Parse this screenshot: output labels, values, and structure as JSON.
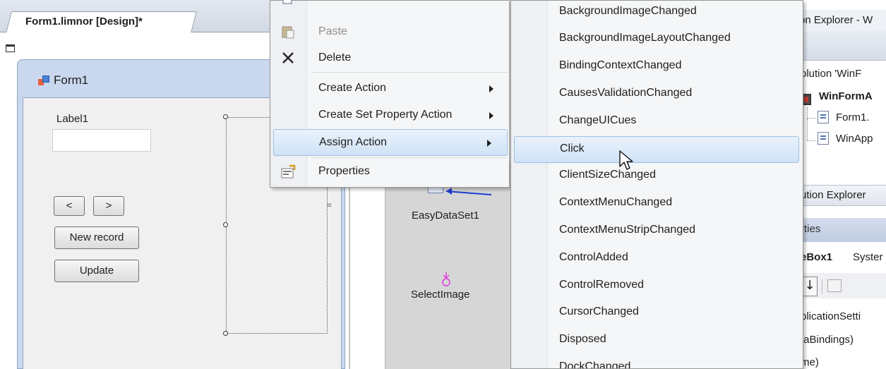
{
  "designer": {
    "tab_label": "Form1.limnor [Design]*",
    "form_title": "Form1",
    "label1": "Label1",
    "prev_button": "<",
    "next_button": ">",
    "new_record_button": "New record",
    "update_button": "Update",
    "tray": {
      "dataset_label": "EasyDataSet1",
      "select_image_label": "SelectImage"
    }
  },
  "context_menu": {
    "items": [
      {
        "label": "Paste",
        "icon": "paste-icon",
        "disabled": true
      },
      {
        "label": "Delete",
        "icon": "delete-icon"
      },
      {
        "label": "Create Action",
        "submenu": true
      },
      {
        "label": "Create Set Property Action",
        "submenu": true
      },
      {
        "label": "Assign Action",
        "submenu": true,
        "highlighted": true
      },
      {
        "label": "Properties",
        "icon": "properties-icon"
      }
    ]
  },
  "submenu": {
    "items": [
      "BackgroundImageChanged",
      "BackgroundImageLayoutChanged",
      "BindingContextChanged",
      "CausesValidationChanged",
      "ChangeUICues",
      "Click",
      "ClientSizeChanged",
      "ContextMenuChanged",
      "ContextMenuStripChanged",
      "ControlAdded",
      "ControlRemoved",
      "CursorChanged",
      "Disposed",
      "DockChanged"
    ],
    "highlighted": "Click"
  },
  "solution_explorer": {
    "header": "on Explorer - W",
    "solution": "olution 'WinF",
    "project": "WinFormA",
    "file1": "Form1.",
    "file2": "WinApp",
    "footer": "ution Explorer"
  },
  "properties": {
    "header": "rties",
    "object_name": "eBox1",
    "object_type": "Syster",
    "rows": [
      "plicationSetti",
      "taBindings)",
      "me)"
    ]
  },
  "colors": {
    "menu_highlight": "#cfe2f6",
    "menu_highlight_border": "#9dc0e6",
    "tray_background": "#d6d6d6",
    "form_frame": "#c9d8ee"
  }
}
